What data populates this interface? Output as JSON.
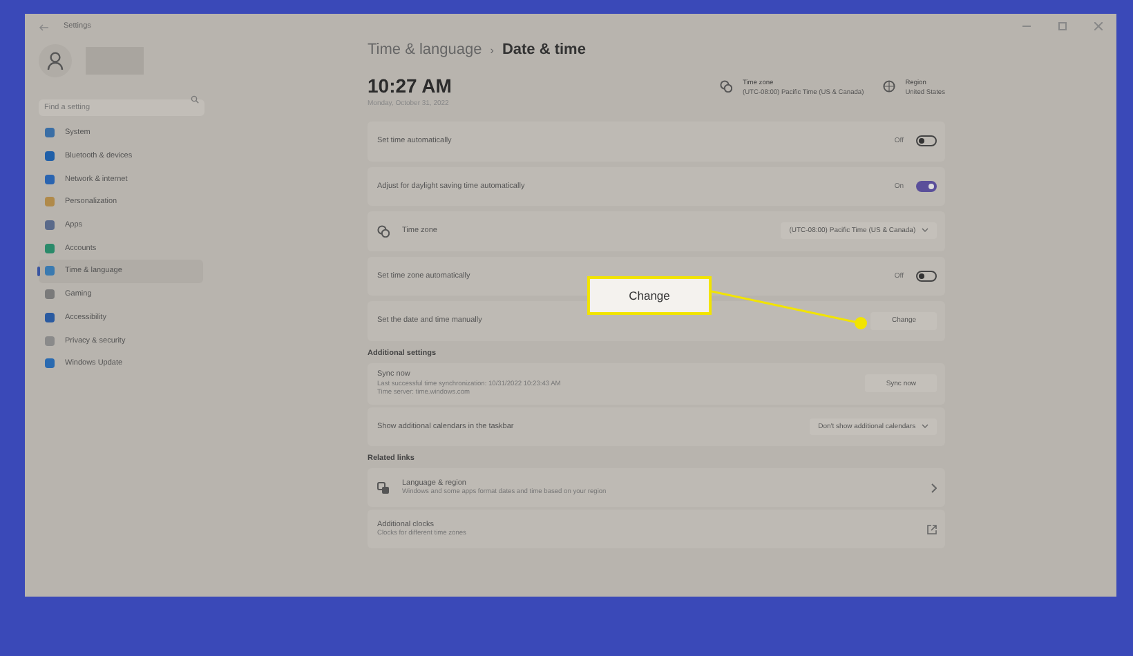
{
  "window": {
    "title": "Settings"
  },
  "sidebar": {
    "search": {
      "placeholder": "Find a setting"
    },
    "items": [
      {
        "label": "System",
        "selected": false
      },
      {
        "label": "Bluetooth & devices",
        "selected": false
      },
      {
        "label": "Network & internet",
        "selected": false
      },
      {
        "label": "Personalization",
        "selected": false
      },
      {
        "label": "Apps",
        "selected": false
      },
      {
        "label": "Accounts",
        "selected": false
      },
      {
        "label": "Time & language",
        "selected": true
      },
      {
        "label": "Gaming",
        "selected": false
      },
      {
        "label": "Accessibility",
        "selected": false
      },
      {
        "label": "Privacy & security",
        "selected": false
      },
      {
        "label": "Windows Update",
        "selected": false
      }
    ]
  },
  "breadcrumb": {
    "parent": "Time & language",
    "separator": "›",
    "current": "Date & time"
  },
  "clock": {
    "time": "10:27 AM",
    "date": "Monday, October 31, 2022"
  },
  "info": [
    {
      "label": "Time zone",
      "value": "(UTC-08:00) Pacific Time (US & Canada)"
    },
    {
      "label": "Region",
      "value": "United States"
    }
  ],
  "settings": [
    {
      "kind": "toggle",
      "label": "Set time automatically",
      "state": "Off",
      "on": false
    },
    {
      "kind": "toggle",
      "label": "Adjust for daylight saving time automatically",
      "state": "On",
      "on": true
    },
    {
      "kind": "dropdown",
      "label": "Time zone",
      "value": "(UTC-08:00) Pacific Time (US & Canada)"
    },
    {
      "kind": "toggle",
      "label": "Set time zone automatically",
      "state": "Off",
      "on": false
    },
    {
      "kind": "button",
      "label": "Set the date and time manually",
      "button": "Change"
    }
  ],
  "additional": {
    "heading": "Additional settings",
    "sync": {
      "title": "Sync now",
      "lines": [
        "Last successful time synchronization: 10/31/2022 10:23:43 AM",
        "Time server: time.windows.com"
      ],
      "button": "Sync now"
    },
    "calendars": {
      "label": "Show additional calendars in the taskbar",
      "value": "Don't show additional calendars"
    }
  },
  "related": {
    "heading": "Related links",
    "links": [
      {
        "kind": "chevron",
        "title": "Language & region",
        "subtitle": "Windows and some apps format dates and time based on your region"
      },
      {
        "kind": "external",
        "title": "Additional clocks",
        "subtitle": "Clocks for different time zones"
      }
    ]
  },
  "callout": {
    "text": "Change"
  }
}
